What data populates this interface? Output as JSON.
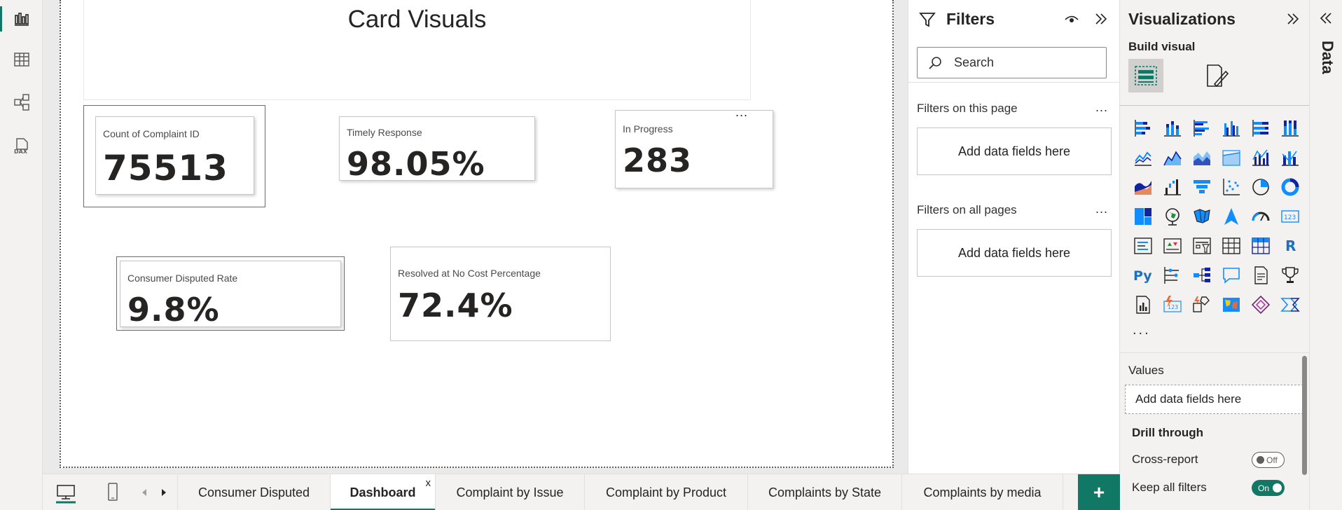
{
  "left_rail": {
    "items": [
      "report-view",
      "table-view",
      "model-view",
      "dax-query-view"
    ],
    "dax_label": "DAX"
  },
  "canvas": {
    "title": "Card Visuals",
    "cards": [
      {
        "label": "Count of Complaint ID",
        "value": "75513"
      },
      {
        "label": "Timely Response",
        "value": "98.05%"
      },
      {
        "label": "In Progress",
        "value": "283",
        "menu": "..."
      },
      {
        "label": "Consumer Disputed Rate",
        "value": "9.8%"
      },
      {
        "label": "Resolved at No Cost Percentage",
        "value": "72.4%"
      }
    ]
  },
  "filters": {
    "title": "Filters",
    "search_placeholder": "Search",
    "this_page": "Filters on this page",
    "all_pages": "Filters on all pages",
    "menu": "...",
    "drop_label": "Add data fields here"
  },
  "visualizations": {
    "title": "Visualizations",
    "build_visual": "Build visual",
    "more": "...",
    "values_title": "Values",
    "values_drop": "Add data fields here",
    "drill_through": "Drill through",
    "cross_report": "Cross-report",
    "cross_report_state": "Off",
    "keep_all_filters": "Keep all filters",
    "keep_all_filters_state": "On",
    "r_label": "R",
    "py_label": "Py",
    "kpi_label": "123"
  },
  "data_pane": {
    "label": "Data"
  },
  "tabs": {
    "pages": [
      "Consumer Disputed",
      "Dashboard",
      "Complaint by Issue",
      "Complaint by Product",
      "Complaints by State",
      "Complaints by media"
    ],
    "active": "Dashboard",
    "close": "x",
    "add": "+"
  },
  "colors": {
    "accent": "#117865",
    "chart_blue": "#118dff",
    "chart_dark": "#12239e",
    "chart_orange": "#e66c37"
  }
}
